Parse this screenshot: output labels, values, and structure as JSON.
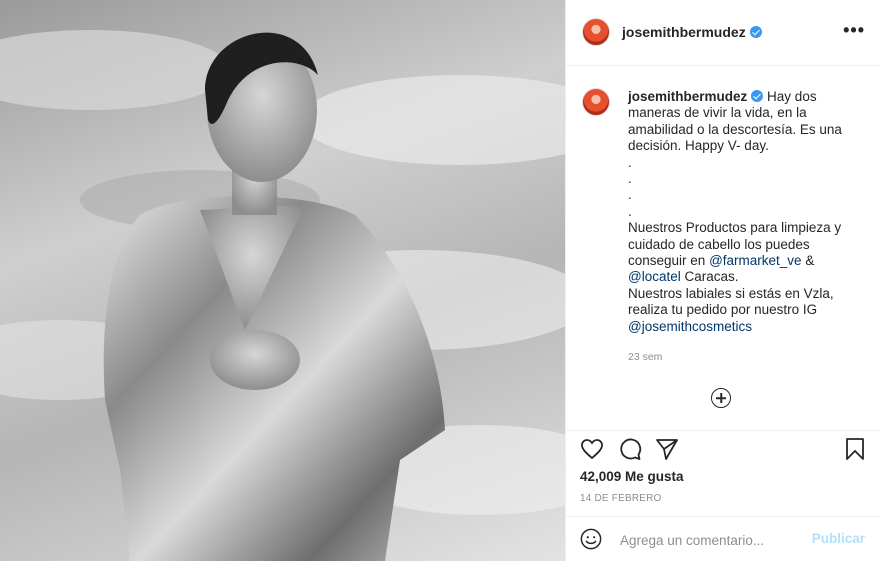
{
  "post": {
    "username": "josemithbermudez",
    "caption_lines": [
      "Hay dos",
      "maneras de vivir la vida, en la",
      "amabilidad o la descortesía. Es una",
      "decisión. Happy V- day.",
      ".",
      ".",
      ".",
      ".",
      "Nuestros Productos para limpieza y",
      "cuidado de cabello los puedes",
      "conseguir en",
      "@farmarket_ve",
      "&",
      "@locatel",
      "Caracas.",
      "Nuestros labiales si estás en Vzla,",
      "realiza tu pedido por nuestro IG",
      "@josemithcosmetics"
    ],
    "time_ago": "23 sem",
    "likes": "42,009 Me gusta",
    "date": "14 DE FEBRERO",
    "comment_placeholder": "Agrega un comentario...",
    "publish_label": "Publicar",
    "more_label": "•••"
  },
  "icons": {
    "verified": "verified-badge-icon",
    "like": "heart-icon",
    "comment": "comment-icon",
    "share": "share-icon",
    "save": "bookmark-icon",
    "load_more": "plus-circle-icon",
    "emoji": "emoji-icon",
    "more": "more-options-icon"
  },
  "colors": {
    "verified": "#3897f0",
    "link": "#00376b",
    "muted": "#8e8e8e",
    "publish_disabled": "#b2dffc"
  }
}
